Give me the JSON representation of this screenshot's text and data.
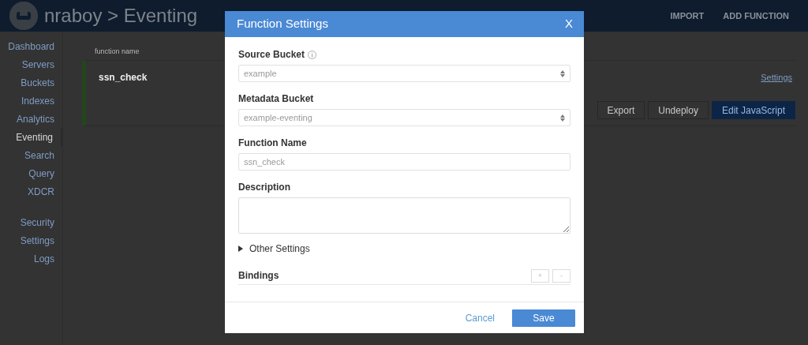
{
  "header": {
    "breadcrumb": "nraboy > Eventing",
    "actions": [
      "IMPORT",
      "ADD FUNCTION"
    ]
  },
  "sidebar": {
    "groups": [
      {
        "items": [
          {
            "label": "Dashboard",
            "selected": false
          },
          {
            "label": "Servers",
            "selected": false
          },
          {
            "label": "Buckets",
            "selected": false
          },
          {
            "label": "Indexes",
            "selected": false
          },
          {
            "label": "Analytics",
            "selected": false
          },
          {
            "label": "Eventing",
            "selected": true
          },
          {
            "label": "Search",
            "selected": false
          },
          {
            "label": "Query",
            "selected": false
          },
          {
            "label": "XDCR",
            "selected": false
          }
        ]
      },
      {
        "items": [
          {
            "label": "Security",
            "selected": false
          },
          {
            "label": "Settings",
            "selected": false
          },
          {
            "label": "Logs",
            "selected": false
          }
        ]
      }
    ]
  },
  "functions_table": {
    "columns": [
      "function name"
    ],
    "rows": [
      {
        "name": "ssn_check",
        "settings_link": "Settings",
        "buttons": [
          {
            "label": "Export",
            "kind": "default"
          },
          {
            "label": "Undeploy",
            "kind": "default"
          },
          {
            "label": "Edit JavaScript",
            "kind": "primary"
          }
        ]
      }
    ]
  },
  "dialog": {
    "title": "Function Settings",
    "close": "X",
    "fields": [
      {
        "kind": "select",
        "label": "Source Bucket",
        "info": true,
        "value": "example"
      },
      {
        "kind": "select",
        "label": "Metadata Bucket",
        "info": false,
        "value": "example-eventing"
      },
      {
        "kind": "input",
        "label": "Function Name",
        "info": false,
        "value": "ssn_check"
      },
      {
        "kind": "textarea",
        "label": "Description",
        "info": false
      }
    ],
    "other_settings": {
      "label": "Other Settings",
      "expanded": false
    },
    "bindings": {
      "label": "Bindings",
      "buttons": [
        "+",
        "-"
      ]
    },
    "footer": {
      "cancel": "Cancel",
      "save": "Save"
    }
  }
}
